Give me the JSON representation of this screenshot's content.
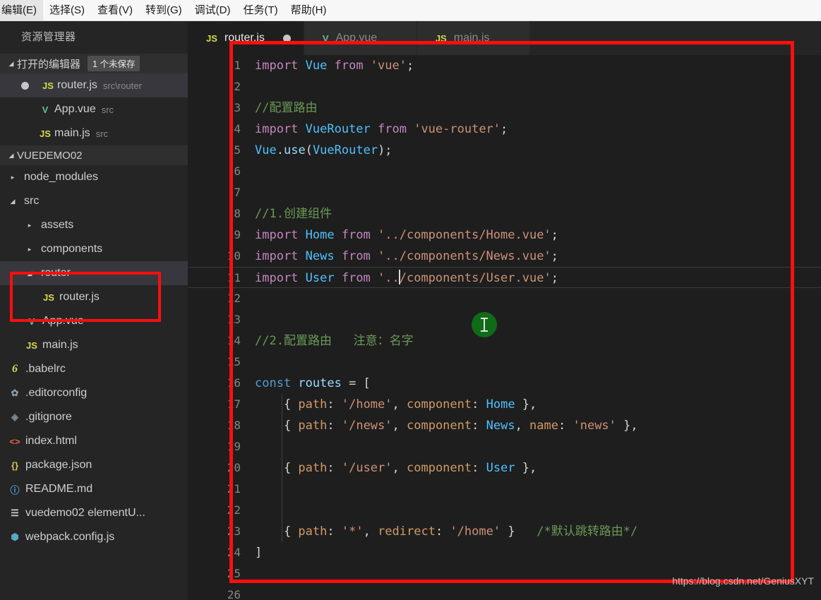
{
  "menubar": {
    "items": [
      {
        "label": "编辑(E)"
      },
      {
        "label": "选择(S)"
      },
      {
        "label": "查看(V)"
      },
      {
        "label": "转到(G)"
      },
      {
        "label": "调试(D)"
      },
      {
        "label": "任务(T)"
      },
      {
        "label": "帮助(H)"
      }
    ]
  },
  "sidebar": {
    "title": "资源管理器",
    "open_editors": {
      "label": "打开的编辑器",
      "badge": "1 个未保存",
      "items": [
        {
          "icon": "js-file-icon",
          "icon_glyph": "JS",
          "name": "router.js",
          "desc": "src\\router",
          "dirty": true
        },
        {
          "icon": "vue-file-icon",
          "icon_glyph": "V",
          "name": "App.vue",
          "desc": "src",
          "dirty": false
        },
        {
          "icon": "js-file-icon",
          "icon_glyph": "JS",
          "name": "main.js",
          "desc": "src",
          "dirty": false
        }
      ]
    },
    "project": {
      "label": "VUEDEMO02",
      "tree": [
        {
          "icon": "folder-icon",
          "icon_glyph": "",
          "name": "node_modules",
          "depth": 1,
          "expanded": false,
          "folder": true
        },
        {
          "icon": "folder-icon",
          "icon_glyph": "",
          "name": "src",
          "depth": 1,
          "expanded": true,
          "folder": true
        },
        {
          "icon": "folder-icon",
          "icon_glyph": "",
          "name": "assets",
          "depth": 2,
          "expanded": false,
          "folder": true
        },
        {
          "icon": "folder-icon",
          "icon_glyph": "",
          "name": "components",
          "depth": 2,
          "expanded": false,
          "folder": true
        },
        {
          "icon": "folder-icon",
          "icon_glyph": "",
          "name": "router",
          "depth": 2,
          "expanded": true,
          "folder": true,
          "selected": true
        },
        {
          "icon": "js-file-icon",
          "icon_glyph": "JS",
          "name": "router.js",
          "depth": 3,
          "folder": false
        },
        {
          "icon": "vue-file-icon",
          "icon_glyph": "V",
          "name": "App.vue",
          "depth": 2,
          "folder": false
        },
        {
          "icon": "js-file-icon",
          "icon_glyph": "JS",
          "name": "main.js",
          "depth": 2,
          "folder": false
        },
        {
          "icon": "babel-file-icon",
          "icon_glyph": "6",
          "name": ".babelrc",
          "depth": 1,
          "folder": false
        },
        {
          "icon": "gear-icon",
          "icon_glyph": "✾",
          "name": ".editorconfig",
          "depth": 1,
          "folder": false
        },
        {
          "icon": "git-file-icon",
          "icon_glyph": "◈",
          "name": ".gitignore",
          "depth": 1,
          "folder": false
        },
        {
          "icon": "html-file-icon",
          "icon_glyph": "<>",
          "name": "index.html",
          "depth": 1,
          "folder": false
        },
        {
          "icon": "json-file-icon",
          "icon_glyph": "{}",
          "name": "package.json",
          "depth": 1,
          "folder": false
        },
        {
          "icon": "info-icon",
          "icon_glyph": "ⓘ",
          "name": "README.md",
          "depth": 1,
          "folder": false
        },
        {
          "icon": "text-file-icon",
          "icon_glyph": "☰",
          "name": "vuedemo02 elementU...",
          "depth": 1,
          "folder": false
        },
        {
          "icon": "webpack-file-icon",
          "icon_glyph": "⬢",
          "name": "webpack.config.js",
          "depth": 1,
          "folder": false
        }
      ]
    }
  },
  "editor": {
    "tabs": [
      {
        "icon_glyph": "JS",
        "icon": "js-file-icon",
        "label": "router.js",
        "active": true,
        "dirty": true
      },
      {
        "icon_glyph": "V",
        "icon": "vue-file-icon",
        "label": "App.vue",
        "active": false,
        "dirty": false
      },
      {
        "icon_glyph": "JS",
        "icon": "js-file-icon",
        "label": "main.js",
        "active": false,
        "dirty": false
      }
    ],
    "lines": [
      {
        "n": "1",
        "tokens": [
          {
            "t": "import ",
            "c": "t-kw"
          },
          {
            "t": "Vue ",
            "c": "t-cls"
          },
          {
            "t": "from ",
            "c": "t-kw"
          },
          {
            "t": "'vue'",
            "c": "t-str"
          },
          {
            "t": ";",
            "c": "t-punc"
          }
        ]
      },
      {
        "n": "2",
        "tokens": []
      },
      {
        "n": "3",
        "tokens": [
          {
            "t": "//配置路由",
            "c": "t-cmt"
          }
        ]
      },
      {
        "n": "4",
        "tokens": [
          {
            "t": "import ",
            "c": "t-kw"
          },
          {
            "t": "VueRouter ",
            "c": "t-cls"
          },
          {
            "t": "from ",
            "c": "t-kw"
          },
          {
            "t": "'vue-router'",
            "c": "t-str"
          },
          {
            "t": ";",
            "c": "t-punc"
          }
        ]
      },
      {
        "n": "5",
        "tokens": [
          {
            "t": "Vue",
            "c": "t-cls"
          },
          {
            "t": ".",
            "c": "t-punc"
          },
          {
            "t": "use",
            "c": "t-var"
          },
          {
            "t": "(",
            "c": "t-punc"
          },
          {
            "t": "VueRouter",
            "c": "t-cls"
          },
          {
            "t": ");",
            "c": "t-punc"
          }
        ]
      },
      {
        "n": "6",
        "tokens": []
      },
      {
        "n": "7",
        "tokens": []
      },
      {
        "n": "8",
        "tokens": [
          {
            "t": "//1.创建组件",
            "c": "t-cmt"
          }
        ]
      },
      {
        "n": "9",
        "tokens": [
          {
            "t": "import ",
            "c": "t-kw"
          },
          {
            "t": "Home ",
            "c": "t-cls"
          },
          {
            "t": "from ",
            "c": "t-kw"
          },
          {
            "t": "'../components/Home.vue'",
            "c": "t-str"
          },
          {
            "t": ";",
            "c": "t-punc"
          }
        ]
      },
      {
        "n": "10",
        "tokens": [
          {
            "t": "import ",
            "c": "t-kw"
          },
          {
            "t": "News ",
            "c": "t-cls"
          },
          {
            "t": "from ",
            "c": "t-kw"
          },
          {
            "t": "'../components/News.vue'",
            "c": "t-str"
          },
          {
            "t": ";",
            "c": "t-punc"
          }
        ]
      },
      {
        "n": "11",
        "tokens": [
          {
            "t": "import ",
            "c": "t-kw"
          },
          {
            "t": "User ",
            "c": "t-cls"
          },
          {
            "t": "from ",
            "c": "t-kw"
          },
          {
            "t": "'..",
            "c": "t-str"
          },
          {
            "t": "|CARET|",
            "c": "caret"
          },
          {
            "t": "/components/User.vue'",
            "c": "t-str"
          },
          {
            "t": ";",
            "c": "t-punc"
          }
        ],
        "current": true
      },
      {
        "n": "12",
        "tokens": []
      },
      {
        "n": "13",
        "tokens": []
      },
      {
        "n": "14",
        "tokens": [
          {
            "t": "//2.配置路由   注意：名字",
            "c": "t-cmt"
          }
        ]
      },
      {
        "n": "15",
        "tokens": []
      },
      {
        "n": "16",
        "tokens": [
          {
            "t": "const ",
            "c": "t-const"
          },
          {
            "t": "routes",
            "c": "t-var"
          },
          {
            "t": " = [",
            "c": "t-punc"
          }
        ]
      },
      {
        "n": "17",
        "tokens": [
          {
            "t": "    { ",
            "c": "t-punc"
          },
          {
            "t": "path",
            "c": "t-prop"
          },
          {
            "t": ": ",
            "c": "t-punc"
          },
          {
            "t": "'/home'",
            "c": "t-str"
          },
          {
            "t": ", ",
            "c": "t-punc"
          },
          {
            "t": "component",
            "c": "t-prop"
          },
          {
            "t": ": ",
            "c": "t-punc"
          },
          {
            "t": "Home",
            "c": "t-cls"
          },
          {
            "t": " },",
            "c": "t-punc"
          }
        ],
        "guide": true
      },
      {
        "n": "18",
        "tokens": [
          {
            "t": "    { ",
            "c": "t-punc"
          },
          {
            "t": "path",
            "c": "t-prop"
          },
          {
            "t": ": ",
            "c": "t-punc"
          },
          {
            "t": "'/news'",
            "c": "t-str"
          },
          {
            "t": ", ",
            "c": "t-punc"
          },
          {
            "t": "component",
            "c": "t-prop"
          },
          {
            "t": ": ",
            "c": "t-punc"
          },
          {
            "t": "News",
            "c": "t-cls"
          },
          {
            "t": ", ",
            "c": "t-punc"
          },
          {
            "t": "name",
            "c": "t-prop"
          },
          {
            "t": ": ",
            "c": "t-punc"
          },
          {
            "t": "'news'",
            "c": "t-str"
          },
          {
            "t": " },",
            "c": "t-punc"
          }
        ],
        "guide": true
      },
      {
        "n": "19",
        "tokens": [],
        "guide": true
      },
      {
        "n": "20",
        "tokens": [
          {
            "t": "    { ",
            "c": "t-punc"
          },
          {
            "t": "path",
            "c": "t-prop"
          },
          {
            "t": ": ",
            "c": "t-punc"
          },
          {
            "t": "'/user'",
            "c": "t-str"
          },
          {
            "t": ", ",
            "c": "t-punc"
          },
          {
            "t": "component",
            "c": "t-prop"
          },
          {
            "t": ": ",
            "c": "t-punc"
          },
          {
            "t": "User",
            "c": "t-cls"
          },
          {
            "t": " },",
            "c": "t-punc"
          }
        ],
        "guide": true
      },
      {
        "n": "21",
        "tokens": [],
        "guide": true
      },
      {
        "n": "22",
        "tokens": [],
        "guide": true
      },
      {
        "n": "23",
        "tokens": [
          {
            "t": "    { ",
            "c": "t-punc"
          },
          {
            "t": "path",
            "c": "t-prop"
          },
          {
            "t": ": ",
            "c": "t-punc"
          },
          {
            "t": "'*'",
            "c": "t-str"
          },
          {
            "t": ", ",
            "c": "t-punc"
          },
          {
            "t": "redirect",
            "c": "t-prop"
          },
          {
            "t": ": ",
            "c": "t-punc"
          },
          {
            "t": "'/home'",
            "c": "t-str"
          },
          {
            "t": " }   ",
            "c": "t-punc"
          },
          {
            "t": "/*默认跳转路由*/",
            "c": "t-cmt"
          }
        ],
        "guide": true
      },
      {
        "n": "24",
        "tokens": [
          {
            "t": "]",
            "c": "t-punc"
          }
        ]
      },
      {
        "n": "25",
        "tokens": []
      },
      {
        "n": "26",
        "tokens": []
      }
    ]
  },
  "annotations": {
    "watermark": "https://blog.csdn.net/GeniusXYT",
    "highlight_color": "#fa0f0f",
    "cursor_color": "#0f6b18"
  }
}
